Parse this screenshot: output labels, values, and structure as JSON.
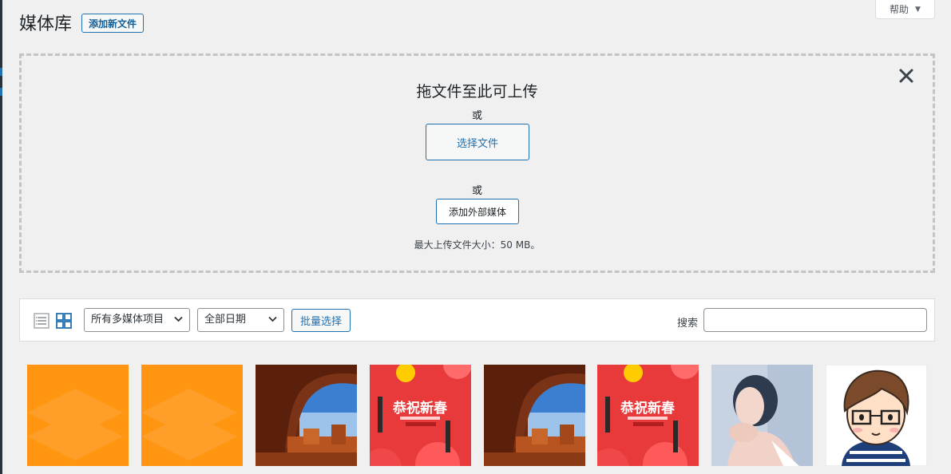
{
  "page": {
    "title": "媒体库",
    "add_new_label": "添加新文件",
    "help_label": "帮助"
  },
  "upload": {
    "title": "拖文件至此可上传",
    "or_1": "或",
    "select_files_label": "选择文件",
    "or_2": "或",
    "add_external_label": "添加外部媒体",
    "max_size": "最大上传文件大小：50 MB。"
  },
  "toolbar": {
    "type_filter_selected": "所有多媒体项目",
    "date_filter_selected": "全部日期",
    "bulk_select_label": "批量选择",
    "search_label": "搜索",
    "search_value": ""
  },
  "thumb_text": {
    "new_year_title": "恭祝新春"
  },
  "media_items": [
    {
      "kind": "orange-pattern"
    },
    {
      "kind": "orange-pattern"
    },
    {
      "kind": "rock-arch-photo"
    },
    {
      "kind": "new-year-poster"
    },
    {
      "kind": "rock-arch-photo"
    },
    {
      "kind": "new-year-poster"
    },
    {
      "kind": "portrait-photo"
    },
    {
      "kind": "cartoon-avatar"
    }
  ],
  "colors": {
    "accent": "#2271b1",
    "background": "#f0f0f1",
    "orange": "#ff9510",
    "poster_red": "#e83a3a"
  }
}
